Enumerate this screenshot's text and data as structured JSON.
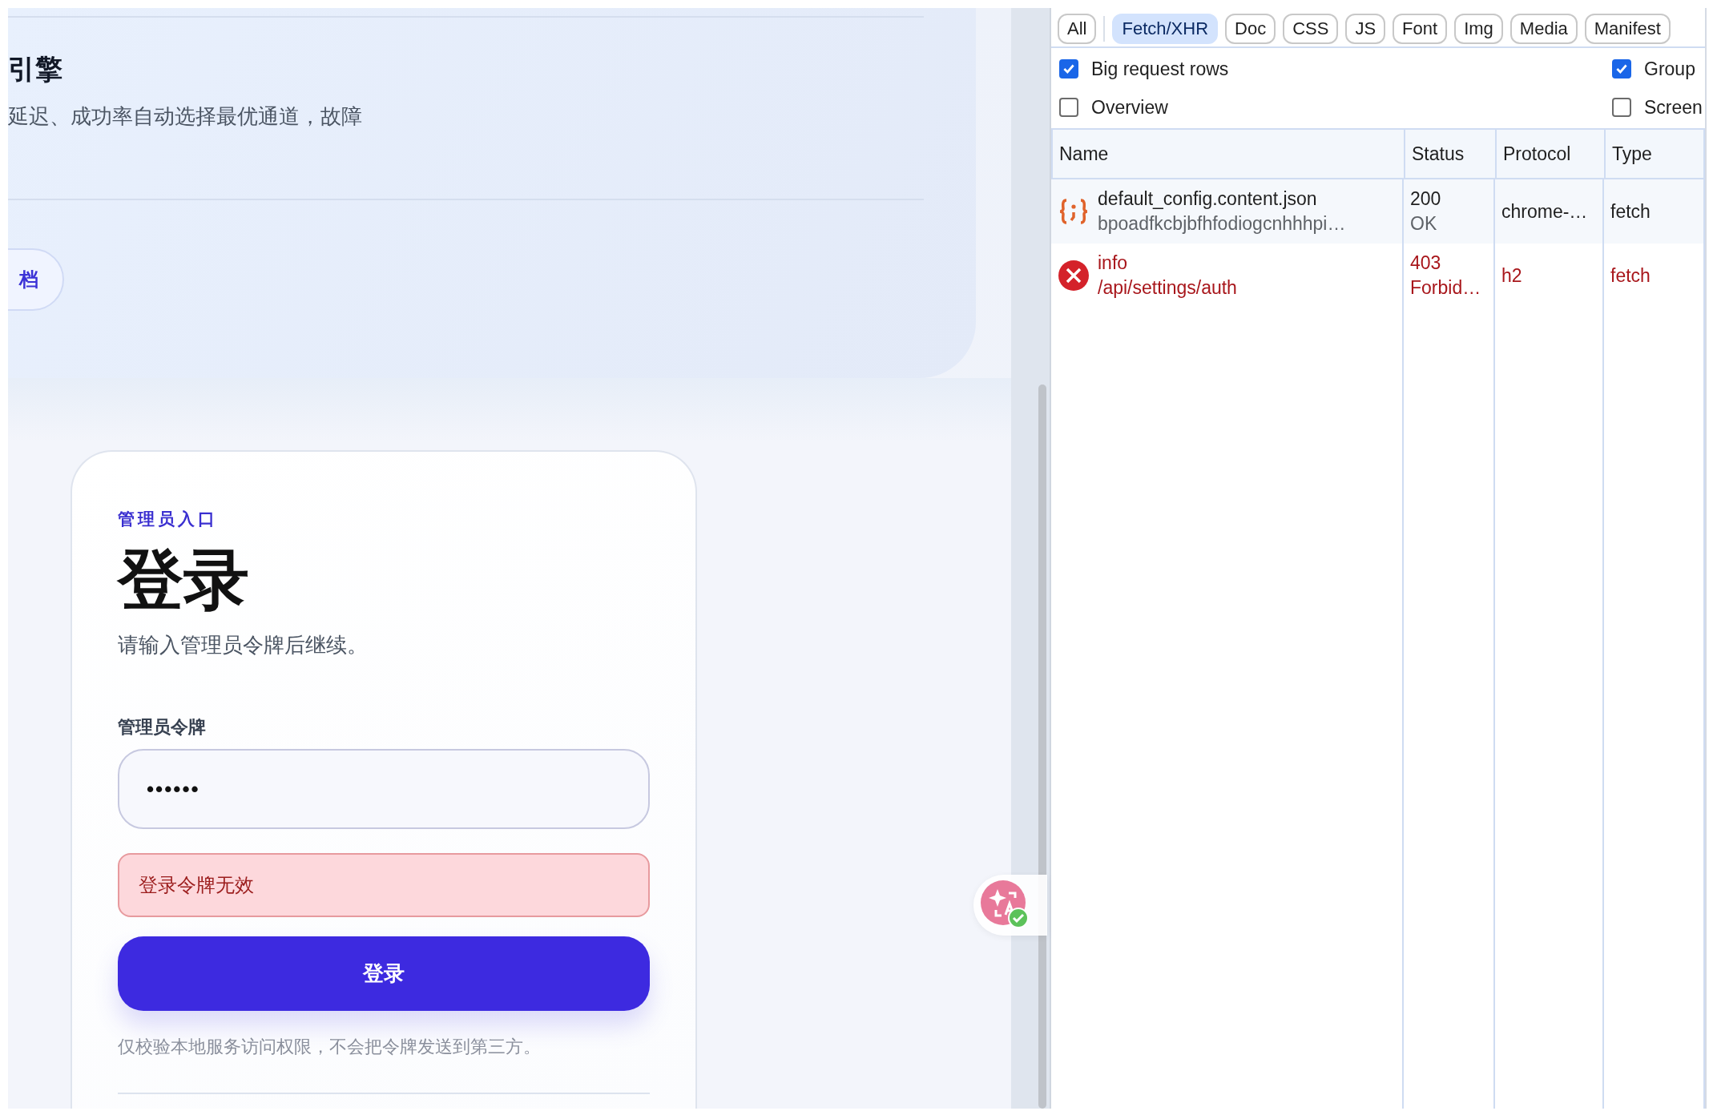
{
  "page": {
    "feature": {
      "title": "引擎",
      "description": "延迟、成功率自动选择最优通道，故障",
      "link": "档"
    },
    "login": {
      "eyebrow": "管理员入口",
      "title": "登录",
      "subtitle": "请输入管理员令牌后继续。",
      "field": {
        "label": "管理员令牌",
        "value": "••••••"
      },
      "error": "登录令牌无效",
      "submit": "登录",
      "note": "仅校验本地服务访问权限，不会把令牌发送到第三方。"
    }
  },
  "devtools": {
    "filters": [
      {
        "label": "All",
        "selected": false
      },
      {
        "label": "Fetch/XHR",
        "selected": true
      },
      {
        "label": "Doc",
        "selected": false
      },
      {
        "label": "CSS",
        "selected": false
      },
      {
        "label": "JS",
        "selected": false
      },
      {
        "label": "Font",
        "selected": false
      },
      {
        "label": "Img",
        "selected": false
      },
      {
        "label": "Media",
        "selected": false
      },
      {
        "label": "Manifest",
        "selected": false
      }
    ],
    "options": [
      {
        "label": "Big request rows",
        "checked": true
      },
      {
        "label": "Group",
        "checked": true
      },
      {
        "label": "Overview",
        "checked": false
      },
      {
        "label": "Screen",
        "checked": false
      }
    ],
    "columns": [
      "Name",
      "Status",
      "Protocol",
      "Type"
    ],
    "requests": [
      {
        "name": "default_config.content.json",
        "path": "bpoadfkcbjbfhfodiogcnhhhpi…",
        "status": "200",
        "status_text": "OK",
        "protocol": "chrome-…",
        "type": "fetch",
        "failed": false
      },
      {
        "name": "info",
        "path": "/api/settings/auth",
        "status": "403",
        "status_text": "Forbid…",
        "protocol": "h2",
        "type": "fetch",
        "failed": true
      }
    ]
  }
}
